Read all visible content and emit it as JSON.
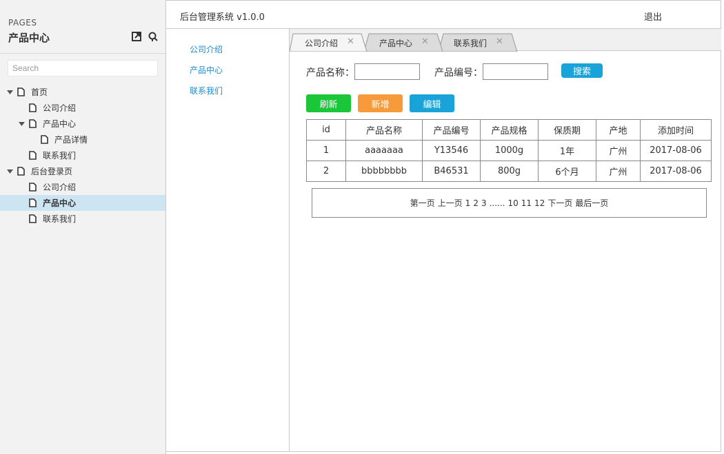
{
  "pages_panel": {
    "heading": "PAGES",
    "title": "产品中心",
    "search_placeholder": "Search",
    "tree": [
      {
        "label": "首页",
        "level": 0,
        "expandable": true,
        "selected": false
      },
      {
        "label": "公司介绍",
        "level": 1,
        "expandable": false,
        "selected": false
      },
      {
        "label": "产品中心",
        "level": 1,
        "expandable": true,
        "selected": false
      },
      {
        "label": "产品详情",
        "level": 2,
        "expandable": false,
        "selected": false
      },
      {
        "label": "联系我们",
        "level": 1,
        "expandable": false,
        "selected": false
      },
      {
        "label": "后台登录页",
        "level": 0,
        "expandable": true,
        "selected": false
      },
      {
        "label": "公司介绍",
        "level": 1,
        "expandable": false,
        "selected": false
      },
      {
        "label": "产品中心",
        "level": 1,
        "expandable": false,
        "selected": true
      },
      {
        "label": "联系我们",
        "level": 1,
        "expandable": false,
        "selected": false
      }
    ]
  },
  "header": {
    "title": "后台管理系统 v1.0.0",
    "logout": "退出"
  },
  "subnav": {
    "items": [
      "公司介绍",
      "产品中心",
      "联系我们"
    ]
  },
  "tabs": [
    {
      "label": "公司介绍",
      "active": true
    },
    {
      "label": "产品中心",
      "active": false
    },
    {
      "label": "联系我们",
      "active": false
    }
  ],
  "tab_close_glyph": "✕",
  "search_form": {
    "name_label": "产品名称：",
    "name_value": "",
    "code_label": "产品编号：",
    "code_value": "",
    "search_button": "搜索"
  },
  "actions": {
    "refresh": "刷新",
    "add": "新增",
    "edit": "编辑"
  },
  "table": {
    "columns": [
      "id",
      "产品名称",
      "产品编号",
      "产品规格",
      "保质期",
      "产地",
      "添加时间"
    ],
    "rows": [
      [
        "1",
        "aaaaaaa",
        "Y13546",
        "1000g",
        "1年",
        "广州",
        "2017-08-06"
      ],
      [
        "2",
        "bbbbbbbb",
        "B46531",
        "800g",
        "6个月",
        "广州",
        "2017-08-06"
      ]
    ]
  },
  "pagination": {
    "first": "第一页",
    "prev": "上一页",
    "pages_start": [
      "1",
      "2",
      "3"
    ],
    "ellipsis": "......",
    "pages_end": [
      "10",
      "11",
      "12"
    ],
    "next": "下一页",
    "last": "最后一页"
  },
  "colors": {
    "link": "#1a8dcf",
    "selected_row": "#cde4f2",
    "refresh_button": "#19c739",
    "add_button": "#f79a3a",
    "edit_button": "#1aa3d9",
    "search_button": "#1aa3d9"
  }
}
